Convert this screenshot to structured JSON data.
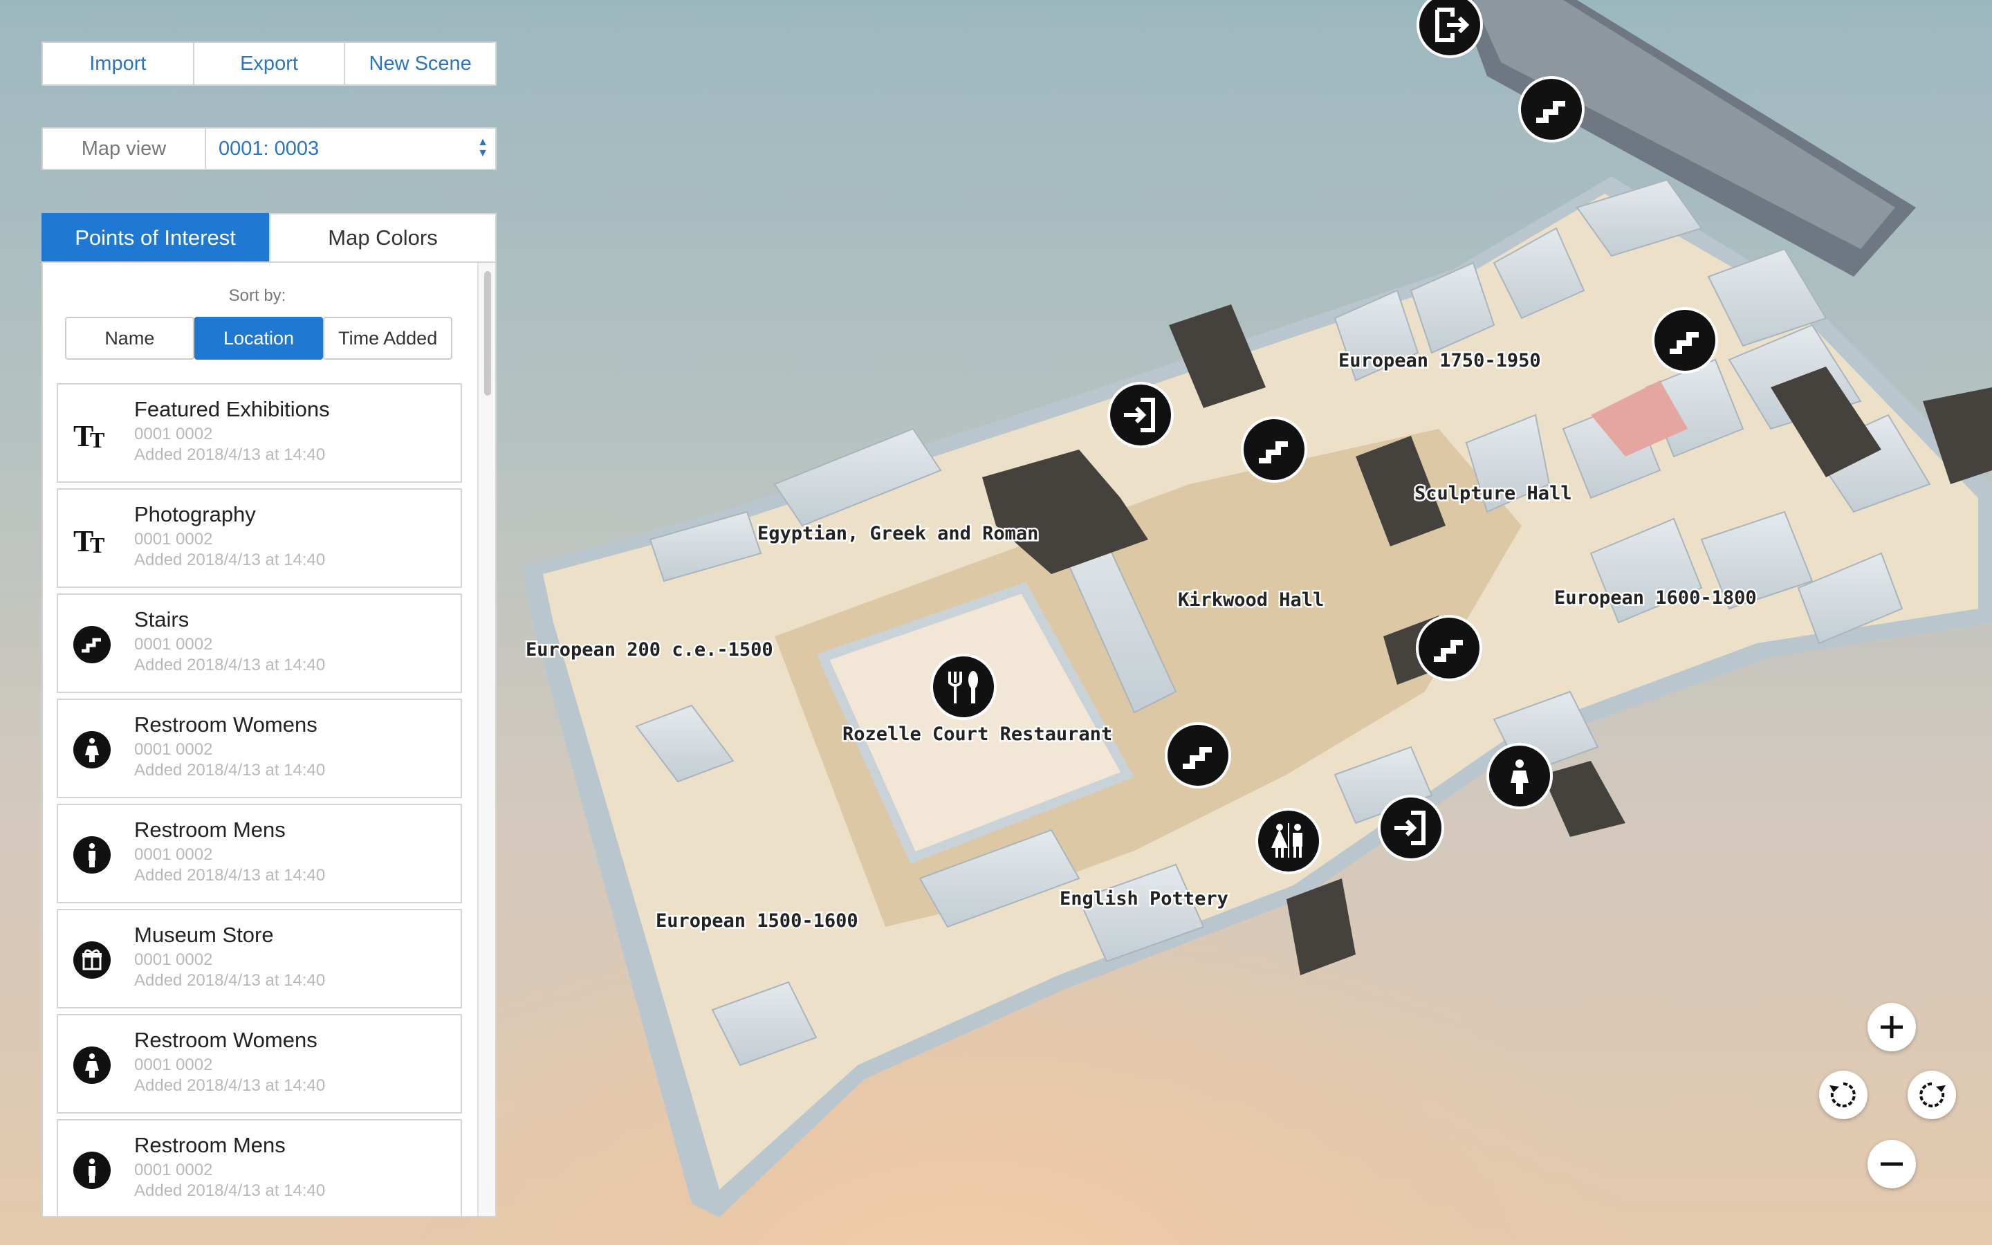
{
  "toolbar": {
    "import_label": "Import",
    "export_label": "Export",
    "new_scene_label": "New Scene"
  },
  "map_view": {
    "label": "Map view",
    "selected": "0001: 0003"
  },
  "tabs": [
    {
      "label": "Points of Interest",
      "active": true
    },
    {
      "label": "Map Colors",
      "active": false
    }
  ],
  "sort": {
    "label": "Sort by:",
    "options": [
      {
        "label": "Name",
        "active": false
      },
      {
        "label": "Location",
        "active": true
      },
      {
        "label": "Time Added",
        "active": false
      }
    ]
  },
  "poi_list": [
    {
      "title": "Featured Exhibitions",
      "location": "0001 0002",
      "added": "Added 2018/4/13 at 14:40",
      "icon": "text-icon"
    },
    {
      "title": "Photography",
      "location": "0001 0002",
      "added": "Added 2018/4/13 at 14:40",
      "icon": "text-icon"
    },
    {
      "title": "Stairs",
      "location": "0001 0002",
      "added": "Added 2018/4/13 at 14:40",
      "icon": "stairs-icon"
    },
    {
      "title": "Restroom Womens",
      "location": "0001 0002",
      "added": "Added 2018/4/13 at 14:40",
      "icon": "restroom-icon"
    },
    {
      "title": "Restroom Mens",
      "location": "0001 0002",
      "added": "Added 2018/4/13 at 14:40",
      "icon": "restroom-icon"
    },
    {
      "title": "Museum Store",
      "location": "0001 0002",
      "added": "Added 2018/4/13 at 14:40",
      "icon": "gift-icon"
    },
    {
      "title": "Restroom Womens",
      "location": "0001 0002",
      "added": "Added 2018/4/13 at 14:40",
      "icon": "restroom-icon"
    },
    {
      "title": "Restroom Mens",
      "location": "0001 0002",
      "added": "Added 2018/4/13 at 14:40",
      "icon": "restroom-icon"
    }
  ],
  "map_labels": {
    "european_1750": "European 1750-1950",
    "sculpture_hall": "Sculpture Hall",
    "egyptian": "Egyptian, Greek and Roman",
    "kirkwood": "Kirkwood Hall",
    "european_1600": "European 1600-1800",
    "european_200": "European 200 c.e.-1500",
    "rozelle": "Rozelle Court Restaurant",
    "european_1500": "European 1500-1600",
    "english_pottery": "English Pottery"
  },
  "map_controls": [
    "zoom-in",
    "rotate-left",
    "rotate-right",
    "zoom-out"
  ]
}
